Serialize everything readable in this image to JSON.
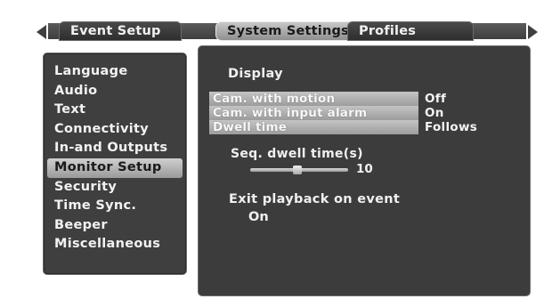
{
  "tabs": [
    {
      "label": "Event Setup",
      "active": false
    },
    {
      "label": "System Settings",
      "active": true
    },
    {
      "label": "Profiles",
      "active": false
    }
  ],
  "sidebar": {
    "items": [
      {
        "label": "Language"
      },
      {
        "label": "Audio"
      },
      {
        "label": "Text"
      },
      {
        "label": "Connectivity"
      },
      {
        "label": "In-and Outputs"
      },
      {
        "label": "Monitor Setup",
        "selected": true
      },
      {
        "label": "Security"
      },
      {
        "label": "Time Sync."
      },
      {
        "label": "Beeper"
      },
      {
        "label": "Miscellaneous"
      }
    ]
  },
  "main": {
    "section_title": "Display",
    "options": [
      {
        "label": "Cam. with motion",
        "value": "Off"
      },
      {
        "label": "Cam. with input alarm",
        "value": "On"
      },
      {
        "label": "Dwell time",
        "value": "Follows"
      }
    ],
    "dwell": {
      "label": "Seq. dwell time(s)",
      "value": "10"
    },
    "exit_playback": {
      "label": "Exit playback on event",
      "value": "On"
    }
  },
  "icons": {
    "left_arrow": "left-arrow-icon",
    "right_arrow": "right-arrow-icon"
  }
}
